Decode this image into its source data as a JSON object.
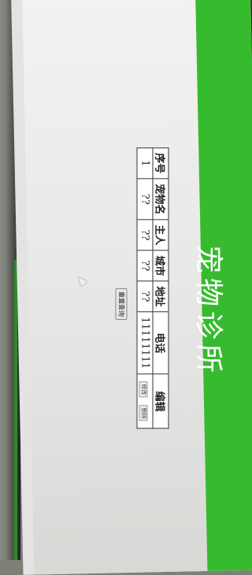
{
  "page": {
    "title": "宠物诊所",
    "search_button": "重置查询"
  },
  "table": {
    "headers": [
      "序号",
      "宠物名",
      "主人",
      "城市",
      "地址",
      "电话",
      "编辑"
    ],
    "rows": [
      {
        "cells": [
          "1",
          "??",
          "??",
          "??",
          "??",
          "11111111"
        ],
        "actions": [
          "修改",
          "删除"
        ]
      }
    ]
  },
  "colors": {
    "banner": "#37bb2e",
    "page_bg": "#eeeeec"
  }
}
